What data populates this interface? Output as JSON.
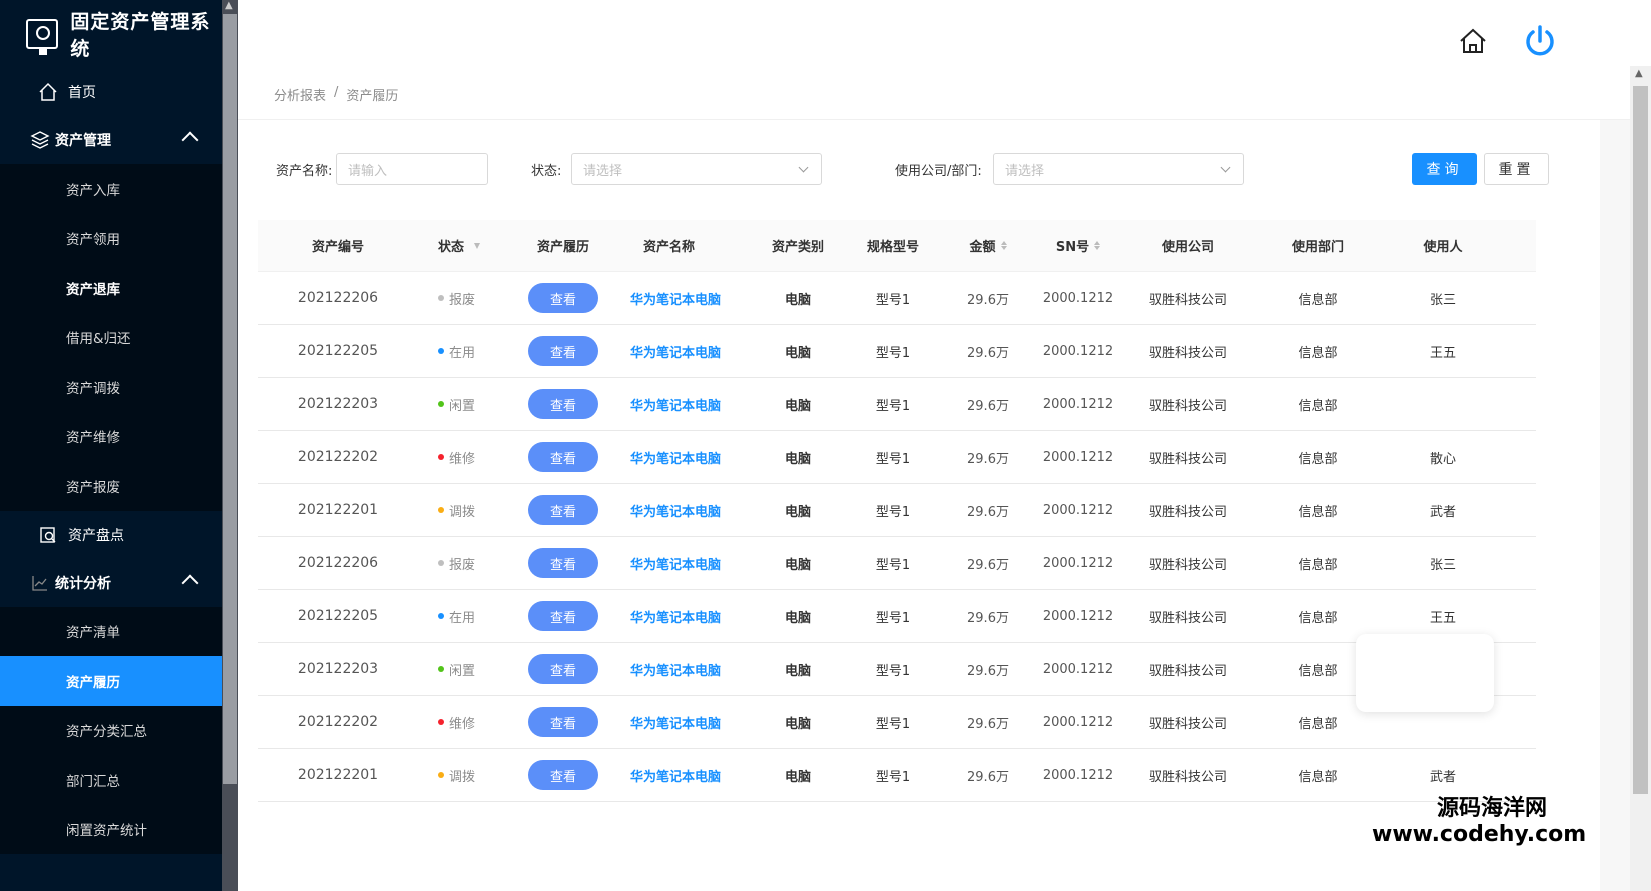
{
  "app": {
    "title": "固定资产管理系统"
  },
  "sidebar": {
    "home": "首页",
    "asset_mgmt": {
      "label": "资产管理",
      "items": [
        "资产入库",
        "资产领用",
        "资产退库",
        "借用&归还",
        "资产调拨",
        "资产维修",
        "资产报废"
      ]
    },
    "inventory": "资产盘点",
    "stats": {
      "label": "统计分析",
      "items": [
        "资产清单",
        "资产履历",
        "资产分类汇总",
        "部门汇总",
        "闲置资产统计"
      ]
    }
  },
  "breadcrumb": {
    "parent": "分析报表",
    "sep": "/",
    "current": "资产履历"
  },
  "filters": {
    "name_label": "资产名称:",
    "name_placeholder": "请输入",
    "status_label": "状态:",
    "status_placeholder": "请选择",
    "company_label": "使用公司/部门:",
    "company_placeholder": "请选择",
    "query_button": "查询",
    "reset_button": "重置"
  },
  "table": {
    "headers": [
      "资产编号",
      "状态",
      "资产履历",
      "资产名称",
      "资产类别",
      "规格型号",
      "金额",
      "SN号",
      "使用公司",
      "使用部门",
      "使用人"
    ],
    "view_label": "查看",
    "rows": [
      {
        "id": "202122206",
        "status": "报废",
        "status_color": "#bfbfbf",
        "name": "华为笔记本电脑",
        "category": "电脑",
        "model": "型号1",
        "amount": "29.6万",
        "sn": "2000.1212",
        "company": "驭胜科技公司",
        "dept": "信息部",
        "user": "张三"
      },
      {
        "id": "202122205",
        "status": "在用",
        "status_color": "#1890ff",
        "name": "华为笔记本电脑",
        "category": "电脑",
        "model": "型号1",
        "amount": "29.6万",
        "sn": "2000.1212",
        "company": "驭胜科技公司",
        "dept": "信息部",
        "user": "王五"
      },
      {
        "id": "202122203",
        "status": "闲置",
        "status_color": "#52c41a",
        "name": "华为笔记本电脑",
        "category": "电脑",
        "model": "型号1",
        "amount": "29.6万",
        "sn": "2000.1212",
        "company": "驭胜科技公司",
        "dept": "信息部",
        "user": ""
      },
      {
        "id": "202122202",
        "status": "维修",
        "status_color": "#f5222d",
        "name": "华为笔记本电脑",
        "category": "电脑",
        "model": "型号1",
        "amount": "29.6万",
        "sn": "2000.1212",
        "company": "驭胜科技公司",
        "dept": "信息部",
        "user": "散心"
      },
      {
        "id": "202122201",
        "status": "调拨",
        "status_color": "#faad14",
        "name": "华为笔记本电脑",
        "category": "电脑",
        "model": "型号1",
        "amount": "29.6万",
        "sn": "2000.1212",
        "company": "驭胜科技公司",
        "dept": "信息部",
        "user": "武者"
      },
      {
        "id": "202122206",
        "status": "报废",
        "status_color": "#bfbfbf",
        "name": "华为笔记本电脑",
        "category": "电脑",
        "model": "型号1",
        "amount": "29.6万",
        "sn": "2000.1212",
        "company": "驭胜科技公司",
        "dept": "信息部",
        "user": "张三"
      },
      {
        "id": "202122205",
        "status": "在用",
        "status_color": "#1890ff",
        "name": "华为笔记本电脑",
        "category": "电脑",
        "model": "型号1",
        "amount": "29.6万",
        "sn": "2000.1212",
        "company": "驭胜科技公司",
        "dept": "信息部",
        "user": "王五"
      },
      {
        "id": "202122203",
        "status": "闲置",
        "status_color": "#52c41a",
        "name": "华为笔记本电脑",
        "category": "电脑",
        "model": "型号1",
        "amount": "29.6万",
        "sn": "2000.1212",
        "company": "驭胜科技公司",
        "dept": "信息部",
        "user": ""
      },
      {
        "id": "202122202",
        "status": "维修",
        "status_color": "#f5222d",
        "name": "华为笔记本电脑",
        "category": "电脑",
        "model": "型号1",
        "amount": "29.6万",
        "sn": "2000.1212",
        "company": "驭胜科技公司",
        "dept": "信息部",
        "user": ""
      },
      {
        "id": "202122201",
        "status": "调拨",
        "status_color": "#faad14",
        "name": "华为笔记本电脑",
        "category": "电脑",
        "model": "型号1",
        "amount": "29.6万",
        "sn": "2000.1212",
        "company": "驭胜科技公司",
        "dept": "信息部",
        "user": "武者"
      }
    ]
  },
  "watermark": {
    "line1": "源码海洋网",
    "line2": "www.codehy.com"
  },
  "colors": {
    "sidebar_bg": "#001529",
    "accent": "#1890ff",
    "view_button": "#5b8ff9"
  }
}
